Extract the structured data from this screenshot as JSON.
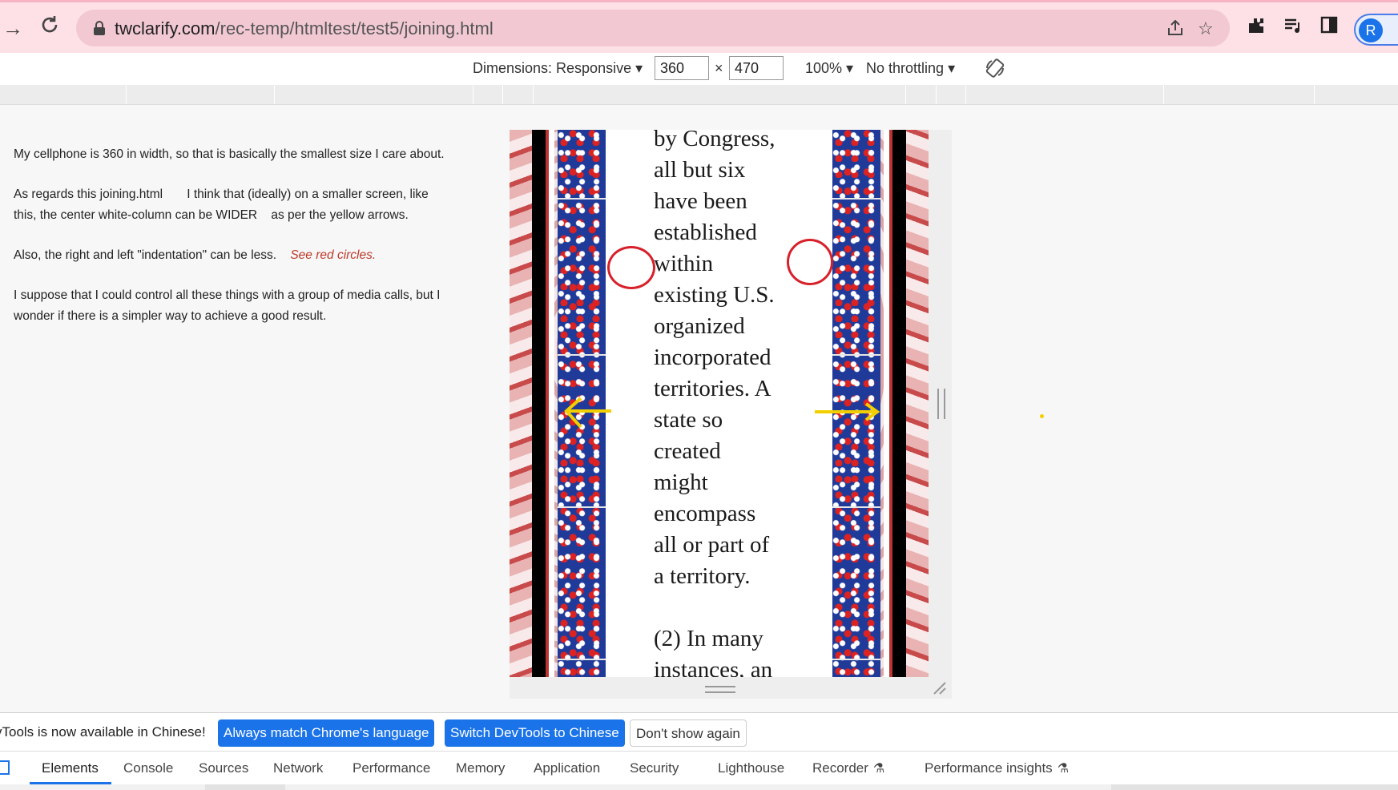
{
  "browser": {
    "url_domain": "twclarify.com",
    "url_path": "/rec-temp/htmltest/test5/joining.html",
    "profile_initial": "R"
  },
  "device_toolbar": {
    "dimensions_label": "Dimensions: Responsive",
    "width": "360",
    "times": "×",
    "height": "470",
    "zoom": "100%",
    "throttling": "No throttling"
  },
  "notes": {
    "p1": "My cellphone is 360 in width, so that is basically the smallest size I care about.",
    "p2_a": "As regards this joining.html",
    "p2_b": "I think that (ideally) on a smaller screen, like this,  the center white-column can be WIDER",
    "p2_c": "as per the yellow arrows.",
    "p3_a": "Also, the right and left \"indentation\" can be less.",
    "p3_b": "See red circles.",
    "p4": "I suppose that I could control all these things with a group of media calls, but I wonder if there is a simpler way to achieve a good result."
  },
  "passage": {
    "para1": "by Congress,\nall but six\nhave been\nestablished\nwithin\nexisting U.S.\norganized\nincorporated\nterritories. A\nstate so\ncreated\nmight\nencompass\nall or part of\na territory.",
    "para2": "(2) In many\ninstances, an"
  },
  "devtools": {
    "lang_msg": "vTools is now available in Chinese!",
    "btn_match": "Always match Chrome's language",
    "btn_switch": "Switch DevTools to Chinese",
    "btn_dismiss": "Don't show again",
    "tabs": [
      "Elements",
      "Console",
      "Sources",
      "Network",
      "Performance",
      "Memory",
      "Application",
      "Security",
      "Lighthouse",
      "Recorder",
      "Performance insights"
    ]
  },
  "colors": {
    "annotation_red": "#d8202a",
    "annotation_yellow": "#f2d000",
    "devtools_blue": "#1a73e8"
  }
}
